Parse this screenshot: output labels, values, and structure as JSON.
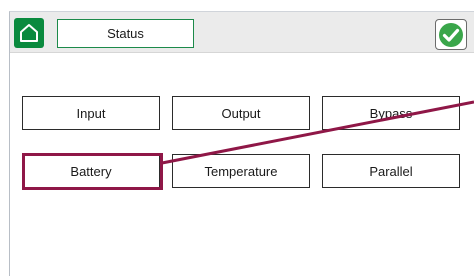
{
  "header": {
    "status_label": "Status"
  },
  "buttons": [
    {
      "label": "Input"
    },
    {
      "label": "Output"
    },
    {
      "label": "Bypass"
    },
    {
      "label": "Battery"
    },
    {
      "label": "Temperature"
    },
    {
      "label": "Parallel"
    }
  ],
  "icons": {
    "home": "home-icon",
    "ok": "checkmark-icon"
  },
  "colors": {
    "brand_green": "#0a8a3e",
    "highlight": "#8f1747",
    "check_green": "#3aa64a"
  }
}
